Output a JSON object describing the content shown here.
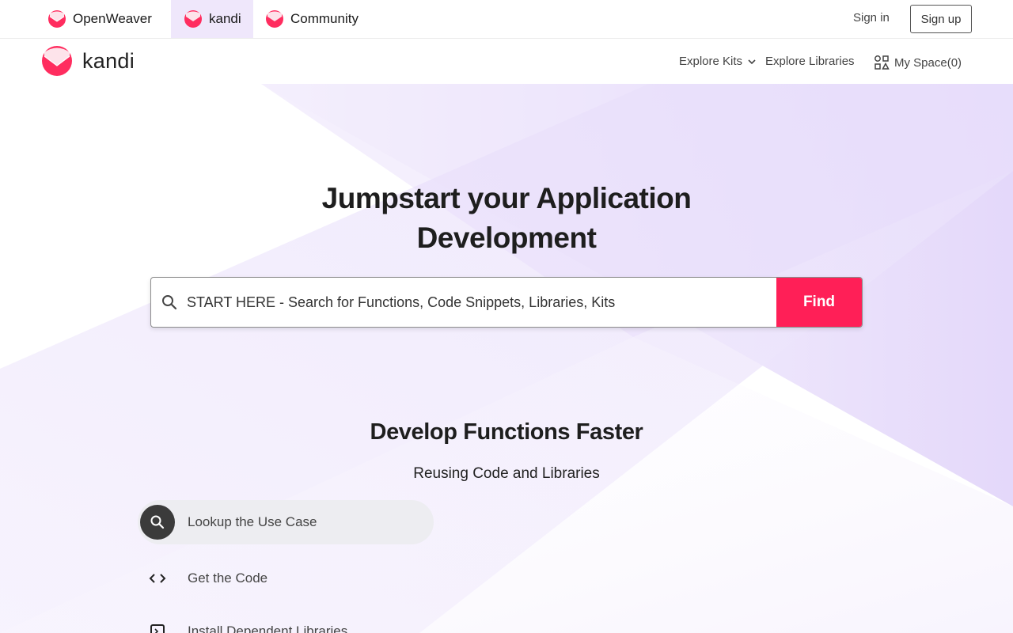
{
  "topbar": {
    "products": [
      {
        "label": "OpenWeaver",
        "active": false
      },
      {
        "label": "kandi",
        "active": true
      },
      {
        "label": "Community",
        "active": false
      }
    ],
    "sign_in": "Sign in",
    "sign_up": "Sign up"
  },
  "header": {
    "brand": "kandi",
    "nav": {
      "explore_kits": "Explore Kits",
      "explore_libraries": "Explore Libraries",
      "my_space": "My Space(0)"
    }
  },
  "hero": {
    "headline_line1": "Jumpstart your Application",
    "headline_line2": "Development",
    "search": {
      "placeholder": "START HERE - Search for Functions, Code Snippets, Libraries, Kits",
      "button": "Find"
    }
  },
  "section": {
    "title": "Develop Functions Faster",
    "subtitle": "Reusing Code and Libraries",
    "steps": [
      {
        "label": "Lookup the Use Case",
        "icon": "search-icon",
        "active": true
      },
      {
        "label": "Get the Code",
        "icon": "code-icon",
        "active": false
      },
      {
        "label": "Install Dependent Libraries",
        "icon": "library-icon",
        "active": false
      }
    ]
  },
  "colors": {
    "accent": "#ff1f57",
    "active_tab_bg": "#efe7fb",
    "hero_tint": "#e6dcfa"
  }
}
